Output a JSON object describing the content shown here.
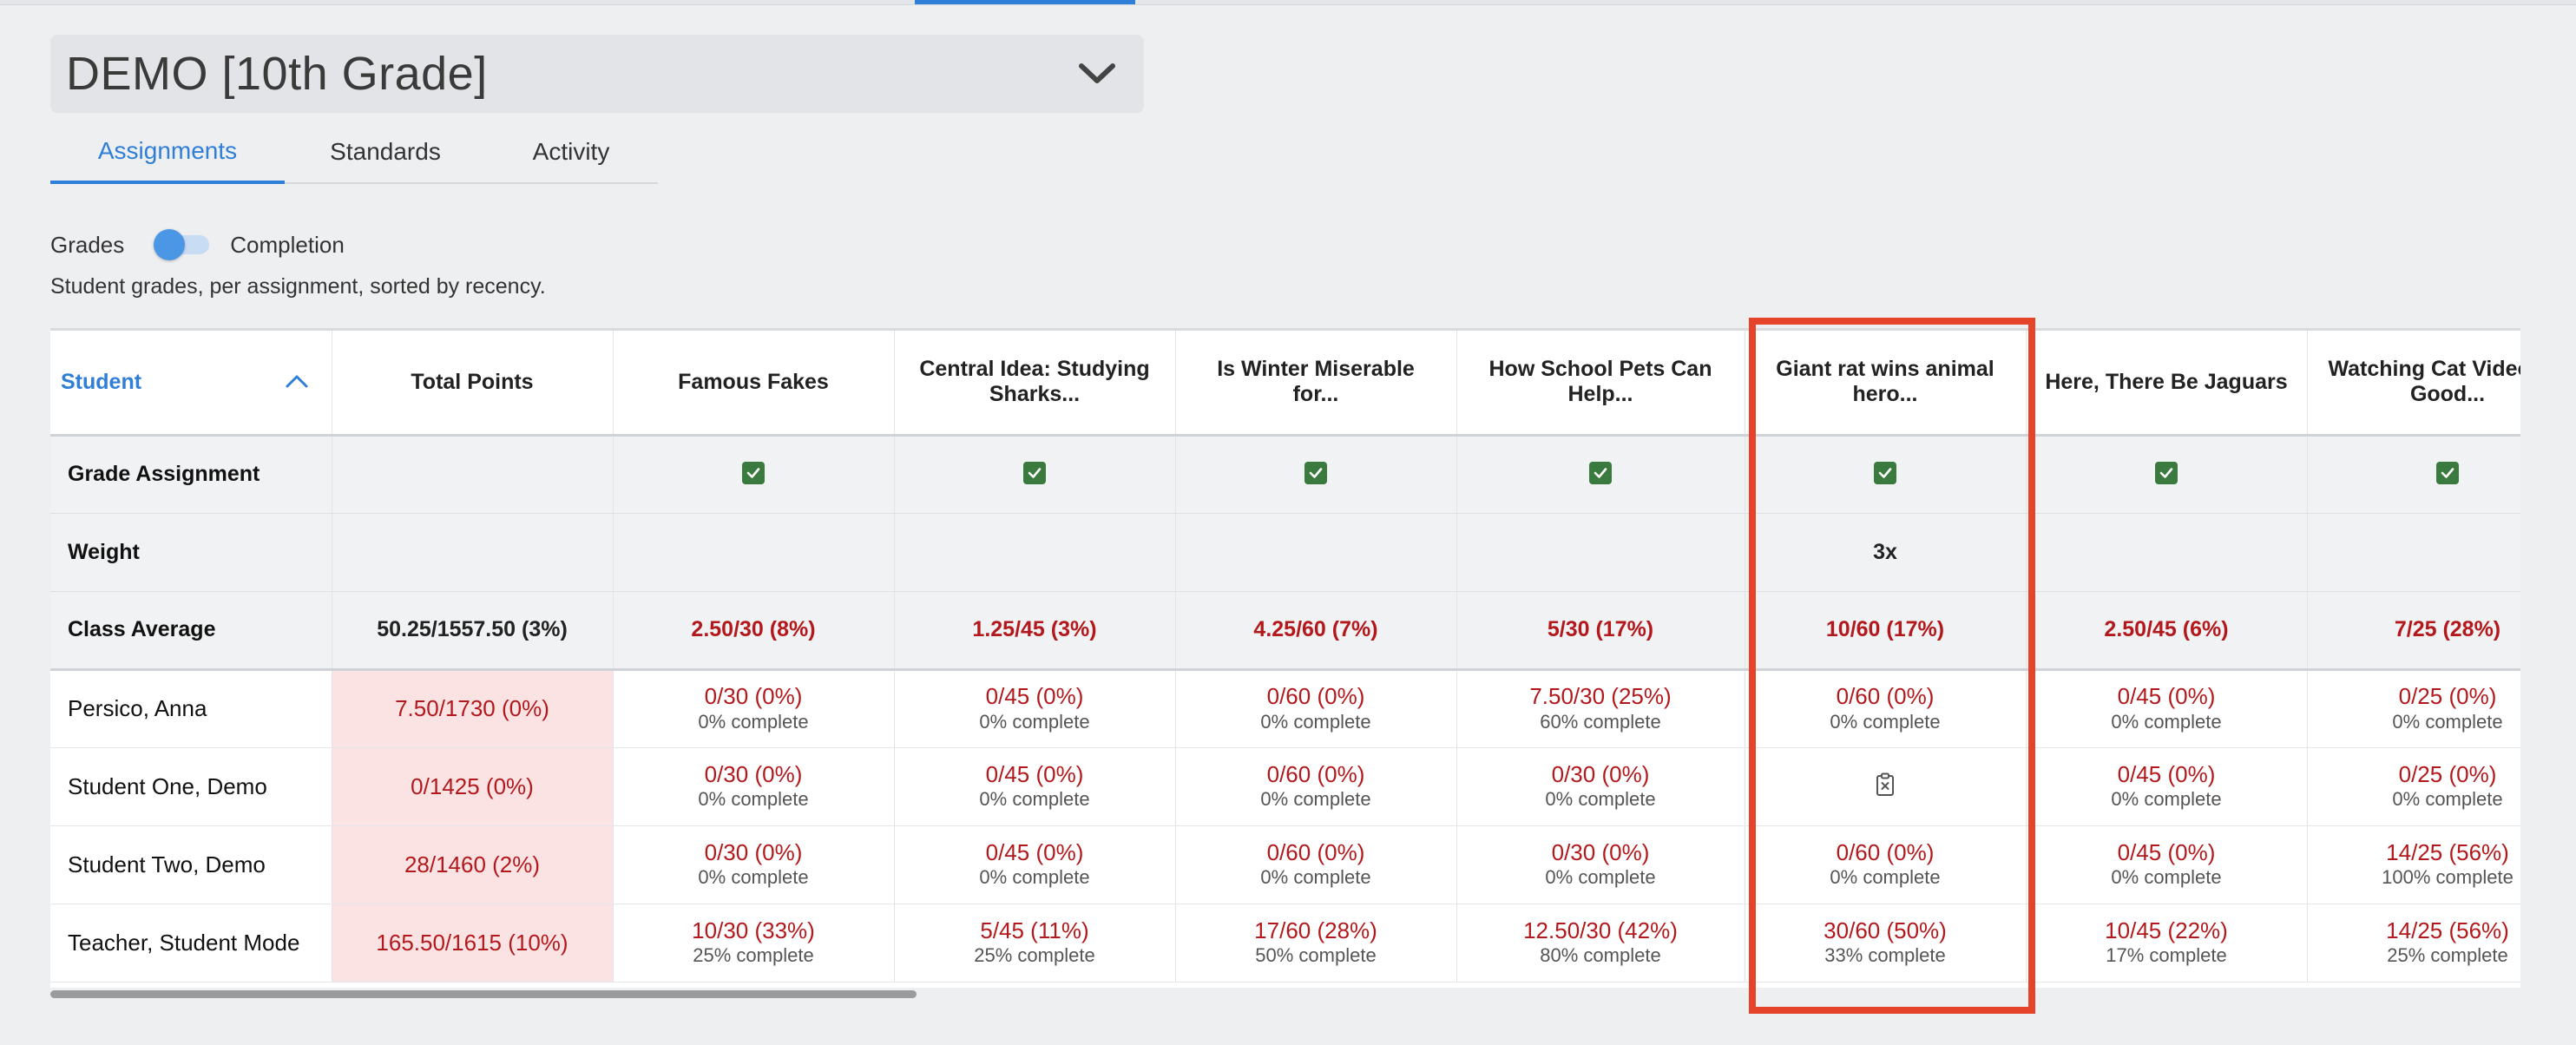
{
  "class_select": {
    "title": "DEMO [10th Grade]",
    "icon": "chevron-down-icon"
  },
  "tabs": [
    {
      "label": "Assignments",
      "active": true
    },
    {
      "label": "Standards",
      "active": false
    },
    {
      "label": "Activity",
      "active": false
    }
  ],
  "toggle": {
    "left_label": "Grades",
    "right_label": "Completion"
  },
  "description": "Student grades, per assignment, sorted by recency.",
  "table": {
    "student_header": "Student",
    "total_header": "Total Points",
    "assignments": [
      "Famous Fakes",
      "Central Idea: Studying Sharks...",
      "Is Winter Miserable for...",
      "How School Pets Can Help...",
      "Giant rat wins animal hero...",
      "Here, There Be Jaguars",
      "Watching Cat Videos Is Good..."
    ],
    "grade_assignment_label": "Grade Assignment",
    "weight_label": "Weight",
    "weights": [
      "",
      "",
      "",
      "",
      "3x",
      "",
      ""
    ],
    "class_average_label": "Class Average",
    "class_average_total": "50.25/1557.50 (3%)",
    "class_averages": [
      "2.50/30 (8%)",
      "1.25/45 (3%)",
      "4.25/60 (7%)",
      "5/30 (17%)",
      "10/60 (17%)",
      "2.50/45 (6%)",
      "7/25 (28%)"
    ],
    "students": [
      {
        "name": "Persico, Anna",
        "total": "7.50/1730 (0%)",
        "cells": [
          {
            "score": "0/30 (0%)",
            "complete": "0% complete"
          },
          {
            "score": "0/45 (0%)",
            "complete": "0% complete"
          },
          {
            "score": "0/60 (0%)",
            "complete": "0% complete"
          },
          {
            "score": "7.50/30 (25%)",
            "complete": "60% complete"
          },
          {
            "score": "0/60 (0%)",
            "complete": "0% complete"
          },
          {
            "score": "0/45 (0%)",
            "complete": "0% complete"
          },
          {
            "score": "0/25 (0%)",
            "complete": "0% complete"
          }
        ]
      },
      {
        "name": "Student One, Demo",
        "total": "0/1425 (0%)",
        "cells": [
          {
            "score": "0/30 (0%)",
            "complete": "0% complete"
          },
          {
            "score": "0/45 (0%)",
            "complete": "0% complete"
          },
          {
            "score": "0/60 (0%)",
            "complete": "0% complete"
          },
          {
            "score": "0/30 (0%)",
            "complete": "0% complete"
          },
          {
            "excused": true
          },
          {
            "score": "0/45 (0%)",
            "complete": "0% complete"
          },
          {
            "score": "0/25 (0%)",
            "complete": "0% complete"
          }
        ]
      },
      {
        "name": "Student Two, Demo",
        "total": "28/1460 (2%)",
        "cells": [
          {
            "score": "0/30 (0%)",
            "complete": "0% complete"
          },
          {
            "score": "0/45 (0%)",
            "complete": "0% complete"
          },
          {
            "score": "0/60 (0%)",
            "complete": "0% complete"
          },
          {
            "score": "0/30 (0%)",
            "complete": "0% complete"
          },
          {
            "score": "0/60 (0%)",
            "complete": "0% complete"
          },
          {
            "score": "0/45 (0%)",
            "complete": "0% complete"
          },
          {
            "score": "14/25 (56%)",
            "complete": "100% complete"
          }
        ]
      },
      {
        "name": "Teacher, Student Mode",
        "total": "165.50/1615 (10%)",
        "cells": [
          {
            "score": "10/30 (33%)",
            "complete": "25% complete"
          },
          {
            "score": "5/45 (11%)",
            "complete": "25% complete"
          },
          {
            "score": "17/60 (28%)",
            "complete": "50% complete"
          },
          {
            "score": "12.50/30 (42%)",
            "complete": "80% complete"
          },
          {
            "score": "30/60 (50%)",
            "complete": "33% complete"
          },
          {
            "score": "10/45 (22%)",
            "complete": "17% complete"
          },
          {
            "score": "14/25 (56%)",
            "complete": "25% complete"
          }
        ]
      }
    ]
  },
  "colors": {
    "accent": "#2f7ed8",
    "negative": "#b3191c",
    "check": "#3a7a3e",
    "highlight": "#e5432a",
    "total_bg": "#fbe3e4"
  }
}
